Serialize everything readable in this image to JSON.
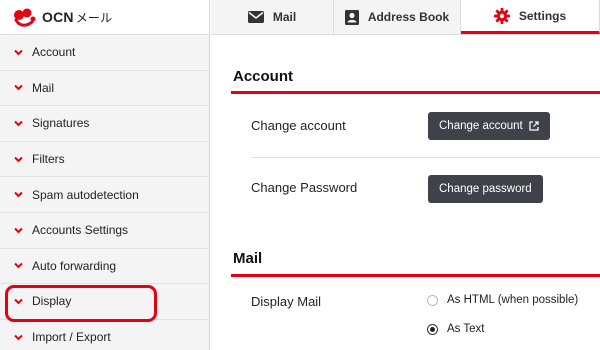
{
  "app": {
    "logo_text": "OCN",
    "logo_kana": "メール"
  },
  "tabs": [
    {
      "label": "Mail",
      "icon": "envelope-icon"
    },
    {
      "label": "Address Book",
      "icon": "contact-card-icon"
    },
    {
      "label": "Settings",
      "icon": "gear-icon",
      "active": true
    }
  ],
  "sidebar": {
    "items": [
      {
        "label": "Account"
      },
      {
        "label": "Mail"
      },
      {
        "label": "Signatures"
      },
      {
        "label": "Filters"
      },
      {
        "label": "Spam autodetection"
      },
      {
        "label": "Accounts Settings"
      },
      {
        "label": "Auto forwarding"
      },
      {
        "label": "Display",
        "highlighted": true
      },
      {
        "label": "Import / Export"
      }
    ]
  },
  "main": {
    "account_section": {
      "title": "Account",
      "change_account_label": "Change account",
      "change_account_button": "Change account",
      "change_password_label": "Change Password",
      "change_password_button": "Change password"
    },
    "mail_section": {
      "title": "Mail",
      "display_mail_label": "Display Mail",
      "options": [
        {
          "label": "As HTML (when possible)",
          "selected": false
        },
        {
          "label": "As Text",
          "selected": true
        }
      ]
    }
  },
  "colors": {
    "accent": "#e60012",
    "button_bg": "#3e434a",
    "sidebar_bg": "#f4f4f4"
  }
}
